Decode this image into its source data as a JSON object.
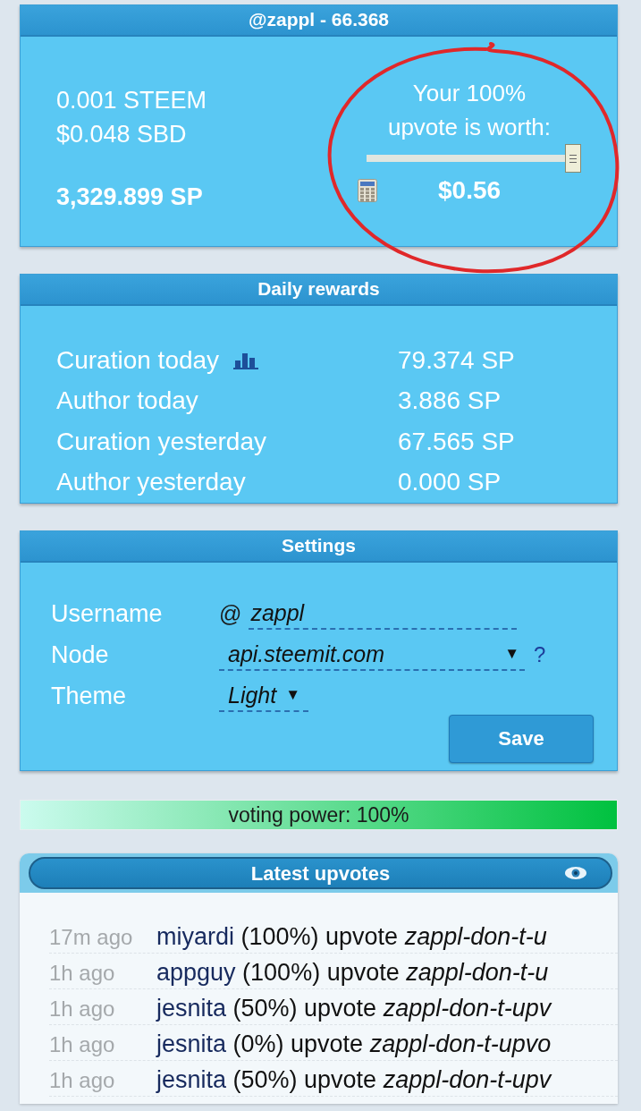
{
  "account": {
    "title": "@zappl - 66.368",
    "steem": "0.001 STEEM",
    "sbd": "$0.048 SBD",
    "sp": "3,329.899 SP",
    "vote_label_lines": [
      "Your 100%",
      "upvote is worth:"
    ],
    "vote_value": "$0.56"
  },
  "daily_rewards": {
    "title": "Daily rewards",
    "rows": [
      {
        "label": "Curation today",
        "value": "79.374 SP",
        "chart_icon": true
      },
      {
        "label": "Author today",
        "value": "3.886 SP",
        "chart_icon": false
      },
      {
        "label": "Curation yesterday",
        "value": "67.565 SP",
        "chart_icon": false
      },
      {
        "label": "Author yesterday",
        "value": "0.000 SP",
        "chart_icon": false
      }
    ]
  },
  "settings": {
    "title": "Settings",
    "fields": [
      {
        "kind": "text",
        "label": "Username",
        "prefix": "@",
        "value": "zappl"
      },
      {
        "kind": "select",
        "label": "Node",
        "value": "api.steemit.com",
        "arrow": "▼",
        "help": "?"
      },
      {
        "kind": "select",
        "label": "Theme",
        "value": "Light",
        "arrow": "▼"
      }
    ],
    "save_button": "Save"
  },
  "voting_power": {
    "label": "voting power: 100%",
    "level": 1.0
  },
  "latest_upvotes": {
    "title": "Latest upvotes",
    "rows": [
      {
        "time": "17m ago",
        "voter": "miyardi",
        "weight": "(100%)",
        "action": "upvote",
        "post": "zappl-don-t-u"
      },
      {
        "time": "1h ago",
        "voter": "appguy",
        "weight": "(100%)",
        "action": "upvote",
        "post": "zappl-don-t-u"
      },
      {
        "time": "1h ago",
        "voter": "jesnita",
        "weight": "(50%)",
        "action": "upvote",
        "post": "zappl-don-t-upv"
      },
      {
        "time": "1h ago",
        "voter": "jesnita",
        "weight": "(0%)",
        "action": "upvote",
        "post": "zappl-don-t-upvo"
      },
      {
        "time": "1h ago",
        "voter": "jesnita",
        "weight": "(50%)",
        "action": "upvote",
        "post": "zappl-don-t-upv"
      }
    ]
  }
}
